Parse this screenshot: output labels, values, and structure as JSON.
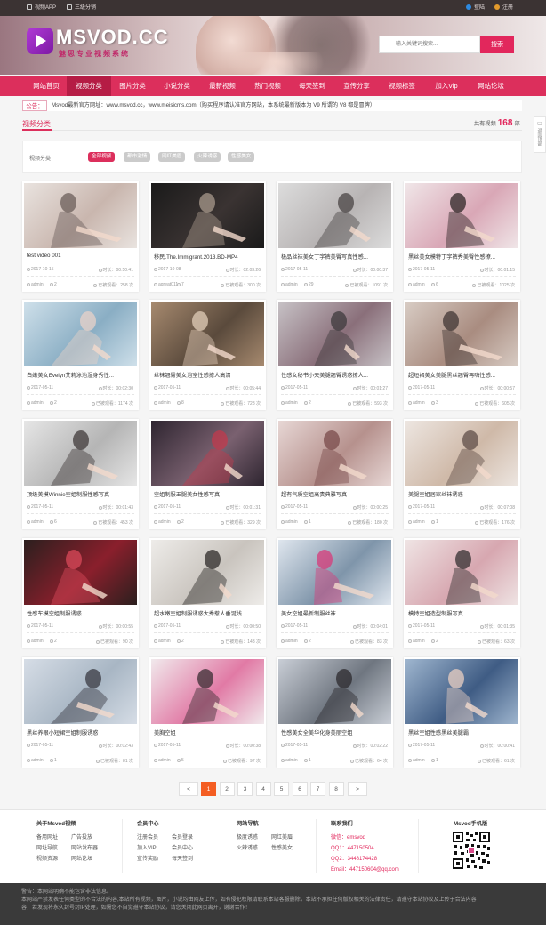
{
  "topbar": {
    "app_label": "视频APP",
    "dist_label": "三级分销",
    "login": "登陆",
    "register": "注册"
  },
  "header": {
    "brand": "MSVOD.CC",
    "slogan": "魅思专业视频系统",
    "search_placeholder": "输入关键词搜索...",
    "search_button": "搜索"
  },
  "nav": [
    "网站首页",
    "视频分类",
    "图片分类",
    "小说分类",
    "最新视频",
    "热门视频",
    "每天签到",
    "宣传分享",
    "视频标签",
    "加入Vip",
    "网站论坛"
  ],
  "nav_active_index": 1,
  "notice": {
    "tag": "公告：",
    "text": "Msvod最新官方网址：www.msvod.cc，www.meisicms.com（购买程序请认准官方网站，本系统最新版本为 V9  所谓的 V8 都是冒牌）"
  },
  "section": {
    "title": "视频分类",
    "total_prefix": "共有视频",
    "total_count": "168",
    "total_suffix": "部"
  },
  "float_button": "返回顶部",
  "filter": {
    "label": "视频分类",
    "chips": [
      "全部视频",
      "都市激情",
      "网红美眉",
      "火辣诱惑",
      "性感美女"
    ],
    "active_index": 0
  },
  "videos": [
    {
      "title": "test video 001",
      "date": "2017-10-15",
      "duration": "时长：00:50:41",
      "author": "admin",
      "likes": "2",
      "views": "已被观看：258 次",
      "colors": [
        "#e9e3df",
        "#c9b6ae",
        "#6b5d5a"
      ]
    },
    {
      "title": "移民.The.Immigrant.2013.BD-MP4",
      "date": "2017-10-08",
      "duration": "时长：02:03:26",
      "author": "agreat011",
      "likes": "7",
      "views": "已被观看：300 次",
      "colors": [
        "#1a1a1a",
        "#3a3332",
        "#a89a8c"
      ]
    },
    {
      "title": "极品丝袜美女丁字裤美臀写真性感...",
      "date": "2017-05-11",
      "duration": "时长：00:00:37",
      "author": "admin",
      "likes": "29",
      "views": "已被观看：1091 次",
      "colors": [
        "#dcdcdc",
        "#b8b4b4",
        "#4a4444"
      ]
    },
    {
      "title": "黑丝美女模特丁字裤秀美臀性感撩...",
      "date": "2017-05-11",
      "duration": "时长：00:01:15",
      "author": "admin",
      "likes": "6",
      "views": "已被观看：1025 次",
      "colors": [
        "#f0e6e8",
        "#d9a7b6",
        "#2e2626"
      ]
    },
    {
      "title": "白嫩美女Evelyn艾莉泳池湿身秀性...",
      "date": "2017-05-11",
      "duration": "时长：00:02:30",
      "author": "admin",
      "likes": "2",
      "views": "已被观看：1174 次",
      "colors": [
        "#cfe0ea",
        "#8aaec4",
        "#e8d2c8"
      ]
    },
    {
      "title": "丝袜翘臀美女浴室性感撩人高清",
      "date": "2017-05-11",
      "duration": "时长：00:05:44",
      "author": "admin",
      "likes": "8",
      "views": "已被观看：728 次",
      "colors": [
        "#a78a6f",
        "#5a4a3c",
        "#e2cdb8"
      ]
    },
    {
      "title": "性感女秘书小天美腿翘臀诱惑撩人...",
      "date": "2017-05-11",
      "duration": "时长：00:01:27",
      "author": "admin",
      "likes": "2",
      "views": "已被观看：593 次",
      "colors": [
        "#c7c2c6",
        "#8a6f7a",
        "#3e3a3c"
      ]
    },
    {
      "title": "超短裙美女美腿黑丝翘臀再嗨性感...",
      "date": "2017-05-11",
      "duration": "时长：00:00:57",
      "author": "admin",
      "likes": "3",
      "views": "已被观看：605 次",
      "colors": [
        "#d8ccc4",
        "#a98c80",
        "#403634"
      ]
    },
    {
      "title": "顶级美模Winnie空姐制服性感写真",
      "date": "2017-05-11",
      "duration": "时长：00:01:43",
      "author": "admin",
      "likes": "6",
      "views": "已被观看：453 次",
      "colors": [
        "#e6e6e6",
        "#b5b5b5",
        "#403a3a"
      ]
    },
    {
      "title": "空姐制服王腿美女性感写真",
      "date": "2017-05-11",
      "duration": "时长：00:01:31",
      "author": "admin",
      "likes": "2",
      "views": "已被观看：329 次",
      "colors": [
        "#2e2530",
        "#7a6170",
        "#c23a4c"
      ]
    },
    {
      "title": "超有气质空姐高贵典雅写真",
      "date": "2017-05-11",
      "duration": "时长：00:00:25",
      "author": "admin",
      "likes": "1",
      "views": "已被观看：180 次",
      "colors": [
        "#e7d7d5",
        "#b6918d",
        "#7a4b4b"
      ]
    },
    {
      "title": "美腿空姐居家丝袜诱惑",
      "date": "2017-05-11",
      "duration": "时长：00:07:08",
      "author": "admin",
      "likes": "1",
      "views": "已被观看：176 次",
      "colors": [
        "#ede6e1",
        "#cfb9a8",
        "#5f4e48"
      ]
    },
    {
      "title": "性感车模空姐制服诱惑",
      "date": "2017-05-11",
      "duration": "时长：00:00:55",
      "author": "admin",
      "likes": "2",
      "views": "已被观看：90 次",
      "colors": [
        "#2b1f1e",
        "#8a1f2c",
        "#d94a5a"
      ]
    },
    {
      "title": "超水嫩空姐制服诱惑大秀惹人垂涎线",
      "date": "2017-05-11",
      "duration": "时长：00:00:50",
      "author": "admin",
      "likes": "2",
      "views": "已被观看：143 次",
      "colors": [
        "#eeece9",
        "#c9c4be",
        "#2d2a28"
      ]
    },
    {
      "title": "美女空姐最新制服丝袜",
      "date": "2017-05-11",
      "duration": "时长：00:04:01",
      "author": "admin",
      "likes": "2",
      "views": "已被观看：83 次",
      "colors": [
        "#dfe6ee",
        "#7f95aa",
        "#d73b7a"
      ]
    },
    {
      "title": "模特空姐造型制服写真",
      "date": "2017-05-11",
      "duration": "时长：00:01:35",
      "author": "admin",
      "likes": "2",
      "views": "已被观看：63 次",
      "colors": [
        "#efe4e4",
        "#d7a7b0",
        "#343031"
      ]
    },
    {
      "title": "黑丝养眼小短裙空姐制服诱惑",
      "date": "2017-05-11",
      "duration": "时长：00:02:43",
      "author": "admin",
      "likes": "1",
      "views": "已被观看：81 次",
      "colors": [
        "#d6dde6",
        "#a8b6c4",
        "#3a3a42"
      ]
    },
    {
      "title": "美胸空姐",
      "date": "2017-05-11",
      "duration": "时长：00:00:38",
      "author": "admin",
      "likes": "5",
      "views": "已被观看：97 次",
      "colors": [
        "#f1e9ec",
        "#e17aa5",
        "#3a2e33"
      ]
    },
    {
      "title": "性感美女全美华化身美丽空姐",
      "date": "2017-05-11",
      "duration": "时长：00:02:22",
      "author": "admin",
      "likes": "1",
      "views": "已被观看：64 次",
      "colors": [
        "#c9ced6",
        "#6f7680",
        "#2c2a2e"
      ]
    },
    {
      "title": "黑丝空姐性感黑丝美腿霸",
      "date": "2017-05-11",
      "duration": "时长：00:00:41",
      "author": "admin",
      "likes": "1",
      "views": "已被观看：61 次",
      "colors": [
        "#9fb6cf",
        "#3f5c84",
        "#e9cfc2"
      ]
    }
  ],
  "pagination": {
    "prev": "<",
    "pages": [
      "1",
      "2",
      "3",
      "4",
      "5",
      "6",
      "7",
      "8"
    ],
    "active": "1",
    "next": ">"
  },
  "footer": {
    "col1": {
      "title": "关于Msvod视频",
      "links": [
        "备用网址",
        "广告投放",
        "网址导航",
        "网站发布器",
        "视频资源",
        "网站论坛"
      ]
    },
    "col2": {
      "title": "会员中心",
      "links": [
        "注册会员",
        "会员登录",
        "加入VIP",
        "会员中心",
        "宣传奖励",
        "每天签到"
      ]
    },
    "col3": {
      "title": "网站导航",
      "links": [
        "极度诱惑",
        "网红美眉",
        "火辣诱惑",
        "性感美女"
      ]
    },
    "col4": {
      "title": "联系我们",
      "links": [
        "微信：emsvod",
        "QQ1：447150504",
        "QQ2：3448174428",
        "Email：447150604@qq.com"
      ]
    },
    "col5": {
      "title": "Msvod手机版"
    }
  },
  "copyright": [
    "警告：本网站明确不能包含非法信息。",
    "本网站严禁发表任何类型的不合法的内容,本站所有视频，图片，小说均由网友上传，如有侵犯权限请联系本站客服删除，本站不承担任何版权相关的法律责任，请遵守本站协议及上传于合法内容",
    "容，若发现将永久封号封IP处理，如需您不自觉遵守本站协议，请您关闭此网页离开，谢谢合作！"
  ],
  "colors": {
    "accent": "#dc2f5c",
    "pager_active": "#f45d22"
  }
}
